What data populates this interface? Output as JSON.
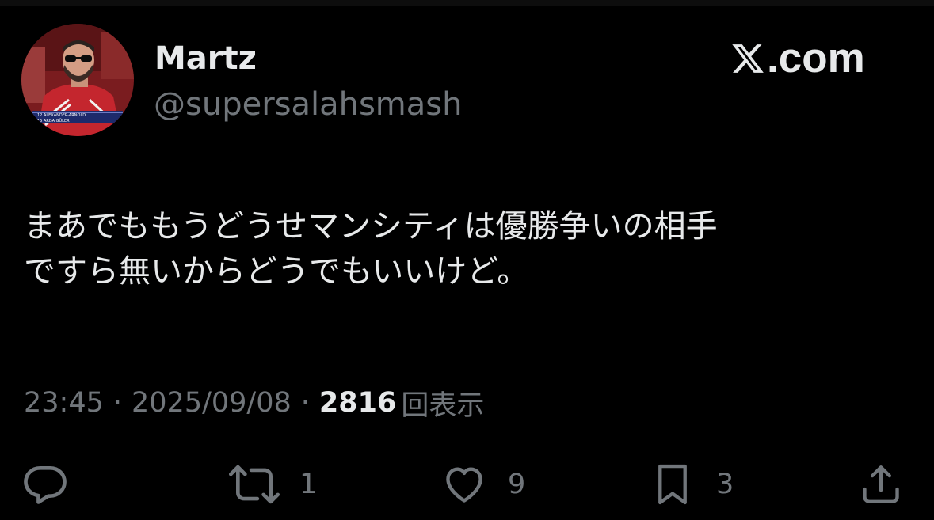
{
  "user": {
    "display_name": "Martz",
    "handle": "@supersalahsmash",
    "avatar_caption_line1": "12 ALEXANDER-ARNOLD",
    "avatar_caption_line2": "15 ARDA GÜLER"
  },
  "brand": {
    "label": "X.com",
    "label_text": ".com"
  },
  "tweet": {
    "text_line1": "まあでももうどうせマンシティは優勝争いの相手",
    "text_line2": "ですら無いからどうでもいいけど。"
  },
  "meta": {
    "time": "23:45",
    "date": "2025/09/08",
    "separator": "·",
    "view_count": "2816",
    "view_label": "回表示"
  },
  "actions": {
    "reply_icon": "reply-icon",
    "retweet_icon": "retweet-icon",
    "retweet_count": "1",
    "like_icon": "heart-icon",
    "like_count": "9",
    "bookmark_icon": "bookmark-icon",
    "bookmark_count": "3",
    "share_icon": "share-icon"
  },
  "colors": {
    "background": "#000000",
    "primary_text": "#e7e9ea",
    "secondary_text": "#71767b"
  }
}
